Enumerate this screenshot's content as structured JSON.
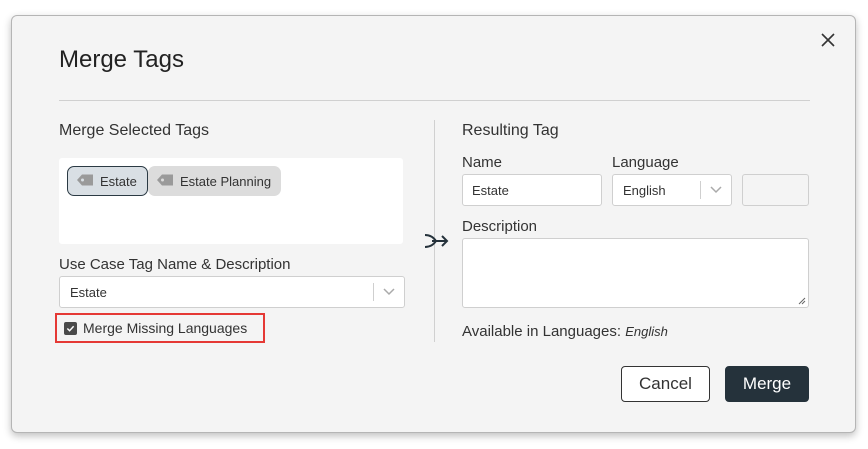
{
  "dialog": {
    "title": "Merge Tags",
    "close_icon": "close-icon"
  },
  "left": {
    "heading": "Merge Selected Tags",
    "tags": [
      {
        "label": "Estate",
        "selected": true,
        "icon": "tag-icon"
      },
      {
        "label": "Estate Planning",
        "selected": false,
        "icon": "tag-icon"
      }
    ],
    "use_case_label": "Use Case Tag Name & Description",
    "use_case_value": "Estate",
    "merge_missing_label": "Merge Missing Languages",
    "merge_missing_checked": true
  },
  "right": {
    "heading": "Resulting Tag",
    "name_label": "Name",
    "name_value": "Estate",
    "language_label": "Language",
    "language_value": "English",
    "description_label": "Description",
    "description_value": "",
    "available_label": "Available in Languages:",
    "available_value": "English"
  },
  "buttons": {
    "cancel": "Cancel",
    "merge": "Merge"
  },
  "colors": {
    "primary": "#25323b",
    "highlight": "#e53935"
  }
}
